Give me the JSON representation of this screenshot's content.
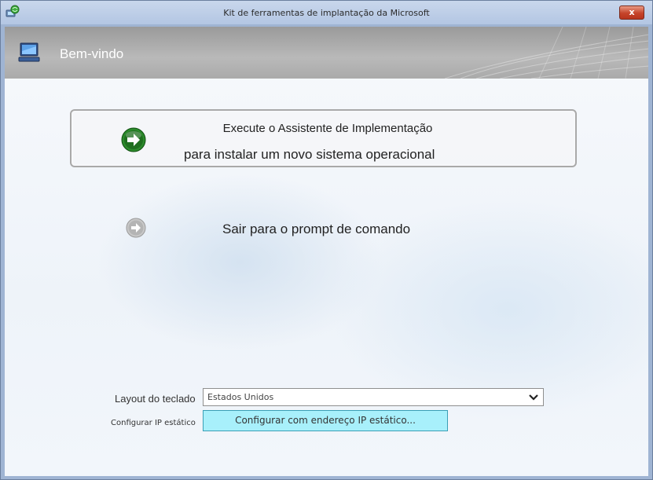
{
  "window": {
    "title": "Kit de ferramentas de implantação da Microsoft",
    "close_label": "x"
  },
  "header": {
    "title": "Bem-vindo"
  },
  "wizard": {
    "line1": "Execute o Assistente de Implementação",
    "line2": "para instalar um novo sistema operacional"
  },
  "command_prompt": {
    "label": "Sair para o prompt de comando"
  },
  "keyboard": {
    "label": "Layout do teclado",
    "selected": "Estados Unidos"
  },
  "static_ip": {
    "label": "Configurar IP estático",
    "button_label": "Configurar com endereço IP estático..."
  },
  "colors": {
    "accent_green": "#2e8b2e",
    "ip_button_bg": "#a8f0fb",
    "header_gray": "#a8a8a8"
  },
  "icons": {
    "title": "computer-globe-icon",
    "header": "computer-icon",
    "wizard": "green-arrow-right-icon",
    "command_prompt": "gray-arrow-right-icon",
    "dropdown": "chevron-down-icon"
  }
}
